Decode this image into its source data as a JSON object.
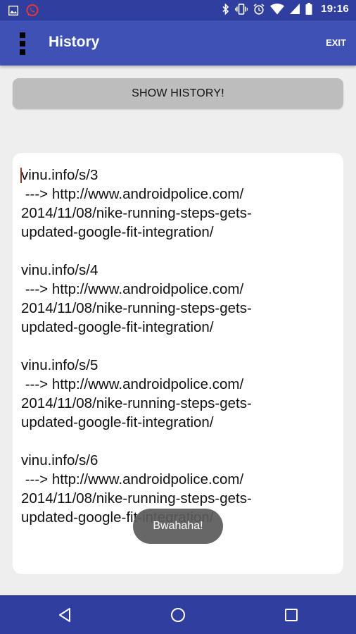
{
  "status_bar": {
    "time": "19:16",
    "left_icons": [
      "image-icon",
      "whatsapp-icon"
    ],
    "right_icons": [
      "bluetooth-icon",
      "vibrate-icon",
      "alarm-icon",
      "wifi-icon",
      "signal-icon",
      "battery-icon"
    ]
  },
  "app_bar": {
    "title": "History",
    "exit_label": "EXIT",
    "menu_icon": "overflow-menu-icon"
  },
  "main": {
    "show_history_label": "SHOW HISTORY!",
    "history_entries": [
      {
        "short_url": "vinu.info/s/3",
        "arrow_line": " ---> http://www.androidpolice.com/",
        "path_line_1": "2014/11/08/nike-running-steps-gets-",
        "path_line_2": "updated-google-fit-integration/"
      },
      {
        "short_url": "vinu.info/s/4",
        "arrow_line": " ---> http://www.androidpolice.com/",
        "path_line_1": "2014/11/08/nike-running-steps-gets-",
        "path_line_2": "updated-google-fit-integration/"
      },
      {
        "short_url": "vinu.info/s/5",
        "arrow_line": " ---> http://www.androidpolice.com/",
        "path_line_1": "2014/11/08/nike-running-steps-gets-",
        "path_line_2": "updated-google-fit-integration/"
      },
      {
        "short_url": "vinu.info/s/6",
        "arrow_line": " ---> http://www.androidpolice.com/",
        "path_line_1": "2014/11/08/nike-running-steps-gets-",
        "path_line_2": "updated-google-fit-integration/"
      }
    ]
  },
  "toast": {
    "message": "Bwahaha!"
  },
  "nav_bar": {
    "buttons": [
      "back-icon",
      "home-icon",
      "recents-icon"
    ]
  },
  "colors": {
    "status_bar": "#303f9f",
    "app_bar": "#3f51b5",
    "button": "#bdbdbd",
    "background": "#eeeeee",
    "toast": "#5a5a5a"
  }
}
